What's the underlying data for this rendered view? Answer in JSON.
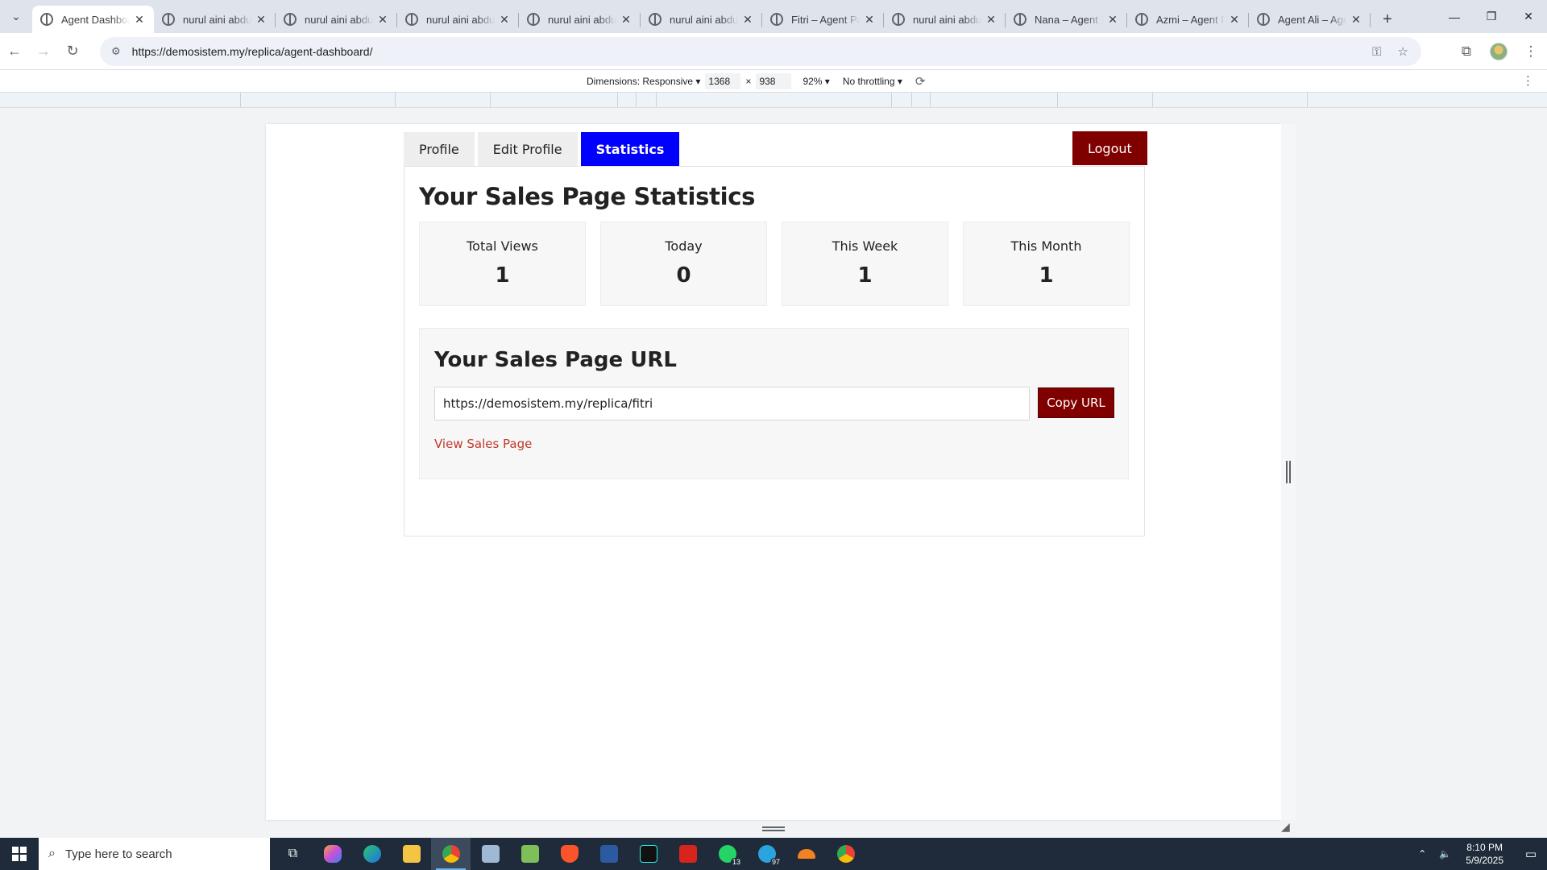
{
  "browser": {
    "tabs": [
      {
        "title": "Agent Dashboard",
        "active": true
      },
      {
        "title": "nurul aini abdul"
      },
      {
        "title": "nurul aini abdul"
      },
      {
        "title": "nurul aini abdul"
      },
      {
        "title": "nurul aini abdul"
      },
      {
        "title": "nurul aini abdul"
      },
      {
        "title": "Fitri – Agent Page"
      },
      {
        "title": "nurul aini abdul"
      },
      {
        "title": "Nana – Agent Page"
      },
      {
        "title": "Azmi – Agent Page"
      },
      {
        "title": "Agent Ali – Agent"
      }
    ],
    "new_tab": "+",
    "close_glyph": "✕",
    "url": "https://demosistem.my/replica/agent-dashboard/"
  },
  "devtools": {
    "dimensions_label": "Dimensions: Responsive ▾",
    "width": "1368",
    "times": "×",
    "height": "938",
    "zoom": "92% ▾",
    "throttling": "No throttling ▾"
  },
  "page": {
    "tabs": [
      "Profile",
      "Edit Profile",
      "Statistics"
    ],
    "active_tab": "Statistics",
    "logout_label": "Logout",
    "heading": "Your Sales Page Statistics",
    "stats": [
      {
        "label": "Total Views",
        "value": "1"
      },
      {
        "label": "Today",
        "value": "0"
      },
      {
        "label": "This Week",
        "value": "1"
      },
      {
        "label": "This Month",
        "value": "1"
      }
    ],
    "url_section": {
      "heading": "Your Sales Page URL",
      "url_value": "https://demosistem.my/replica/fitri",
      "copy_label": "Copy URL",
      "view_link": "View Sales Page"
    },
    "colors": {
      "primary_tab": "#0000ff",
      "button": "#800000",
      "link": "#c0392b"
    }
  },
  "taskbar": {
    "search_placeholder": "Type here to search",
    "time": "8:10 PM",
    "date": "5/9/2025",
    "whatsapp_badge": "13",
    "telegram_badge": "97"
  }
}
